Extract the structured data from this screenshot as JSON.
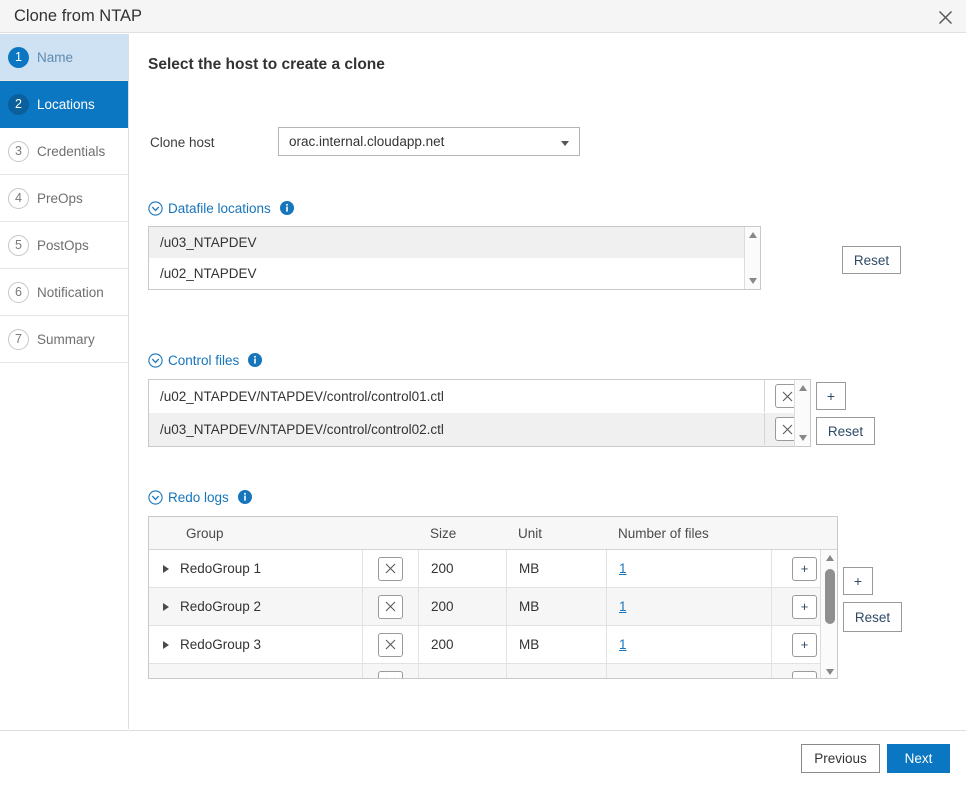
{
  "window": {
    "title": "Clone from NTAP",
    "close_icon": "close-icon"
  },
  "sidebar": {
    "items": [
      {
        "num": "1",
        "label": "Name",
        "state": "done"
      },
      {
        "num": "2",
        "label": "Locations",
        "state": "active"
      },
      {
        "num": "3",
        "label": "Credentials",
        "state": "todo"
      },
      {
        "num": "4",
        "label": "PreOps",
        "state": "todo"
      },
      {
        "num": "5",
        "label": "PostOps",
        "state": "todo"
      },
      {
        "num": "6",
        "label": "Notification",
        "state": "todo"
      },
      {
        "num": "7",
        "label": "Summary",
        "state": "todo"
      }
    ]
  },
  "main": {
    "page_title": "Select the host to create a clone",
    "clone_host": {
      "label": "Clone host",
      "value": "orac.internal.cloudapp.net",
      "caret_icon": "chevron-down-icon"
    },
    "datafile_locations": {
      "title": "Datafile locations",
      "collapse_icon": "circle-chevron-down-icon",
      "info_icon": "info-icon",
      "items": [
        "/u02_NTAPDEV",
        "/u03_NTAPDEV"
      ],
      "reset_label": "Reset"
    },
    "control_files": {
      "title": "Control files",
      "collapse_icon": "circle-chevron-down-icon",
      "info_icon": "info-icon",
      "items": [
        "/u02_NTAPDEV/NTAPDEV/control/control01.ctl",
        "/u03_NTAPDEV/NTAPDEV/control/control02.ctl"
      ],
      "delete_icon": "close-icon",
      "add_label": "+",
      "reset_label": "Reset"
    },
    "redo_logs": {
      "title": "Redo logs",
      "collapse_icon": "circle-chevron-down-icon",
      "info_icon": "info-icon",
      "columns": [
        "Group",
        "Size",
        "Unit",
        "Number of files"
      ],
      "rows": [
        {
          "group": "RedoGroup 1",
          "size": "200",
          "unit": "MB",
          "files": "1"
        },
        {
          "group": "RedoGroup 2",
          "size": "200",
          "unit": "MB",
          "files": "1"
        },
        {
          "group": "RedoGroup 3",
          "size": "200",
          "unit": "MB",
          "files": "1"
        }
      ],
      "expand_icon": "triangle-right-icon",
      "delete_icon": "close-icon",
      "row_add_label": "+",
      "add_label": "+",
      "reset_label": "Reset"
    }
  },
  "footer": {
    "previous_label": "Previous",
    "next_label": "Next"
  },
  "colors": {
    "accent": "#0b77c2",
    "link": "#1775bb",
    "step_done_bg": "#cfe2f3"
  }
}
